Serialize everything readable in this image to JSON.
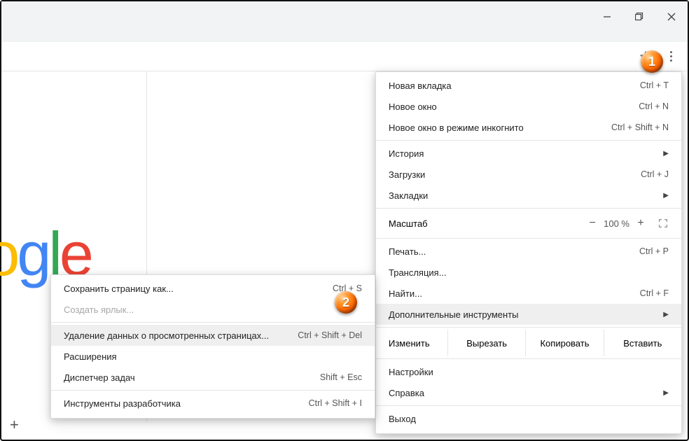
{
  "window_controls": {
    "minimize": "minimize",
    "maximize": "maximize",
    "close": "close"
  },
  "toolbar": {
    "star": "star",
    "menu": "menu"
  },
  "menu": {
    "new_tab": {
      "label": "Новая вкладка",
      "shortcut": "Ctrl + T"
    },
    "new_window": {
      "label": "Новое окно",
      "shortcut": "Ctrl + N"
    },
    "incognito": {
      "label": "Новое окно в режиме инкогнито",
      "shortcut": "Ctrl + Shift + N"
    },
    "history": {
      "label": "История"
    },
    "downloads": {
      "label": "Загрузки",
      "shortcut": "Ctrl + J"
    },
    "bookmarks": {
      "label": "Закладки"
    },
    "zoom": {
      "label": "Масштаб",
      "value": "100 %",
      "minus": "−",
      "plus": "+"
    },
    "print": {
      "label": "Печать...",
      "shortcut": "Ctrl + P"
    },
    "cast": {
      "label": "Трансляция..."
    },
    "find": {
      "label": "Найти...",
      "shortcut": "Ctrl + F"
    },
    "more_tools": {
      "label": "Дополнительные инструменты"
    },
    "edit": {
      "label": "Изменить",
      "cut": "Вырезать",
      "copy": "Копировать",
      "paste": "Вставить"
    },
    "settings": {
      "label": "Настройки"
    },
    "help": {
      "label": "Справка"
    },
    "exit": {
      "label": "Выход"
    }
  },
  "submenu": {
    "save_page": {
      "label": "Сохранить страницу как...",
      "shortcut": "Ctrl + S"
    },
    "create_shortcut": {
      "label": "Создать ярлык..."
    },
    "clear_data": {
      "label": "Удаление данных о просмотренных страницах...",
      "shortcut": "Ctrl + Shift + Del"
    },
    "extensions": {
      "label": "Расширения"
    },
    "task_manager": {
      "label": "Диспетчер задач",
      "shortcut": "Shift + Esc"
    },
    "dev_tools": {
      "label": "Инструменты разработчика",
      "shortcut": "Ctrl + Shift + I"
    }
  },
  "logo": {
    "text": "Google"
  },
  "badges": {
    "b1": "1",
    "b2": "2"
  },
  "plus": "+"
}
